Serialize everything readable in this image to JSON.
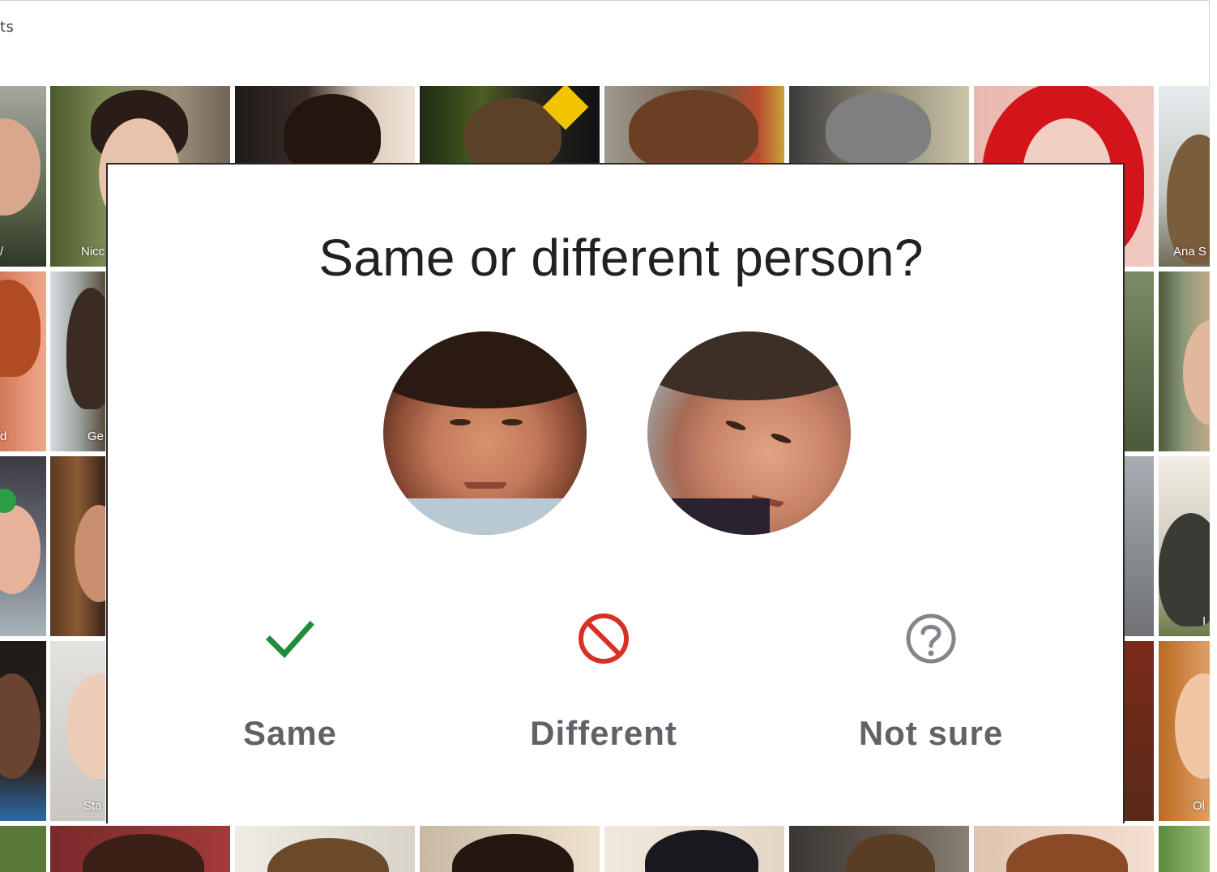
{
  "colors": {
    "accent_green": "#1e8e3e",
    "accent_red": "#d93025",
    "neutral_grey": "#80868b",
    "label_grey": "#5f6368",
    "title": "#202124"
  },
  "header": {
    "partial_title": "ts"
  },
  "background_tiles": {
    "names": {
      "row1_col2": "Nicc",
      "row1_col1": "/",
      "row1_col8": "Ana S",
      "row2_col1": "d",
      "row2_col2": "Ge",
      "row3_col8": "I",
      "row4_col2": "Sta",
      "row4_col8": "Ol"
    }
  },
  "dialog": {
    "title": "Same or different person?",
    "faces": [
      {
        "name": "face-photo-left"
      },
      {
        "name": "face-photo-right"
      }
    ],
    "choices": {
      "same": {
        "label": "Same",
        "icon": "check-icon"
      },
      "different": {
        "label": "Different",
        "icon": "prohibited-icon"
      },
      "not_sure": {
        "label": "Not sure",
        "icon": "question-circle-icon"
      }
    }
  }
}
